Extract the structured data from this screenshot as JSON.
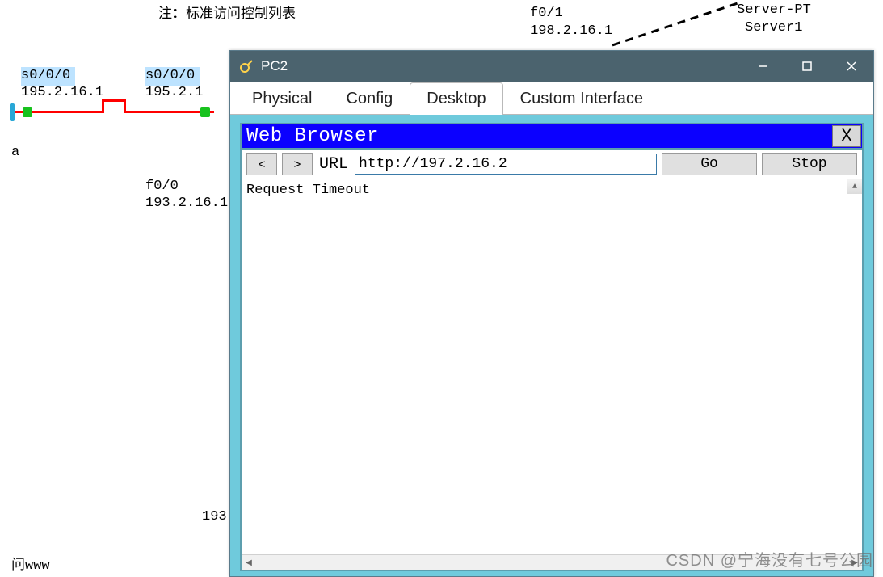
{
  "bg": {
    "note": "注：标准访问控制列表",
    "f01_if": "f0/1",
    "f01_ip": "198.2.16.1",
    "server_type": "Server-PT",
    "server_name": "Server1",
    "s000_left_if": "s0/0/0",
    "s000_left_ip": "195.2.16.1",
    "s000_right_if": "s0/0/0",
    "s000_right_ip": "195.2.1",
    "letter_a": "a",
    "f00_if": "f0/0",
    "f00_ip": "193.2.16.1",
    "ip_partial": "193",
    "bottom_left": "问www"
  },
  "window": {
    "title": "PC2",
    "tabs": [
      "Physical",
      "Config",
      "Desktop",
      "Custom Interface"
    ],
    "active_tab": 2
  },
  "browser": {
    "app_title": "Web Browser",
    "close_label": "X",
    "back_glyph": "<",
    "fwd_glyph": ">",
    "url_label": "URL",
    "url_value": "http://197.2.16.2",
    "go_label": "Go",
    "stop_label": "Stop",
    "content": "Request Timeout"
  },
  "watermark": "CSDN @宁海没有七号公园"
}
